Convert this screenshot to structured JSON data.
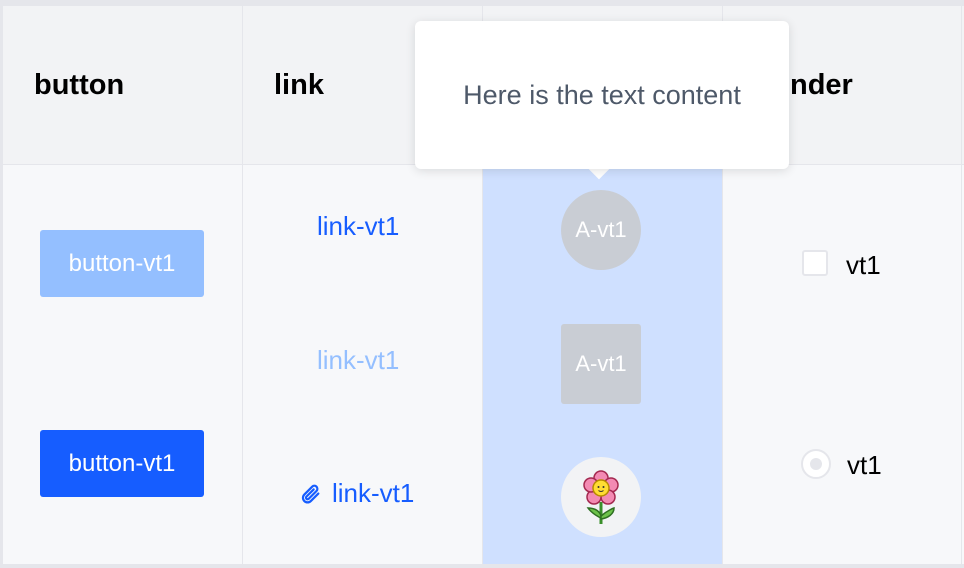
{
  "table": {
    "headers": {
      "button": "button",
      "link": "link",
      "render": "nder"
    },
    "buttons": [
      {
        "label": "button-vt1",
        "state": "disabled"
      },
      {
        "label": "button-vt1",
        "state": "primary"
      }
    ],
    "links": [
      {
        "label": "link-vt1",
        "state": "normal"
      },
      {
        "label": "link-vt1",
        "state": "disabled"
      },
      {
        "label": "link-vt1",
        "state": "with-icon",
        "icon": "paperclip-icon"
      }
    ],
    "avatars": [
      {
        "text": "A-vt1",
        "shape": "circle"
      },
      {
        "text": "A-vt1",
        "shape": "square"
      },
      {
        "text": "",
        "shape": "circle",
        "icon": "flower-icon"
      }
    ],
    "options": [
      {
        "type": "checkbox",
        "label": "vt1",
        "checked": false
      },
      {
        "type": "radio",
        "label": "vt1",
        "checked": false
      }
    ]
  },
  "tooltip": {
    "text": "Here is the text content"
  },
  "colors": {
    "primary": "#165dff",
    "primary_light": "#94bfff",
    "highlight_column": "#cfe0ff",
    "avatar_bg": "#c9cdd4"
  }
}
